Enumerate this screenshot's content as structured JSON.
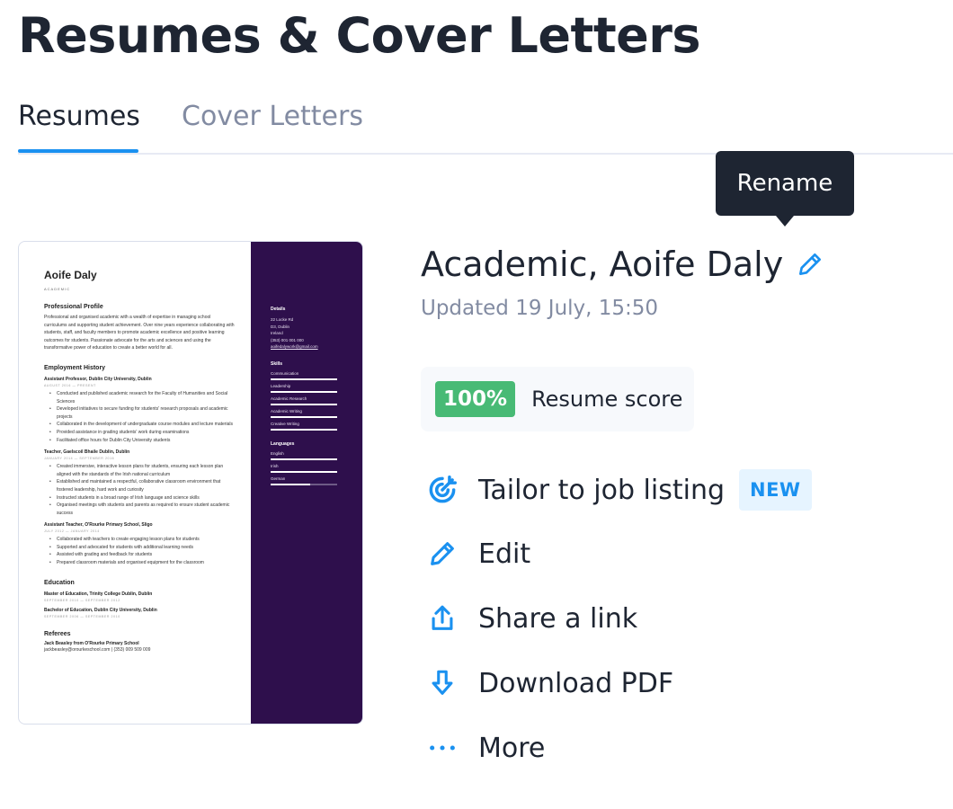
{
  "page": {
    "title": "Resumes & Cover Letters"
  },
  "tabs": [
    {
      "label": "Resumes",
      "active": true
    },
    {
      "label": "Cover Letters",
      "active": false
    }
  ],
  "tooltip": {
    "text": "Rename"
  },
  "document": {
    "title": "Academic, Aoife Daly",
    "updated": "Updated 19 July, 15:50",
    "score": {
      "value": "100%",
      "label": "Resume score"
    }
  },
  "actions": [
    {
      "label": "Tailor to job listing",
      "icon": "target-icon",
      "badge": "NEW"
    },
    {
      "label": "Edit",
      "icon": "pencil-icon"
    },
    {
      "label": "Share a link",
      "icon": "share-icon"
    },
    {
      "label": "Download PDF",
      "icon": "download-icon"
    },
    {
      "label": "More",
      "icon": "more-dots-icon"
    }
  ],
  "colors": {
    "accent": "#1a91f0",
    "text": "#1e2532",
    "muted": "#828ba2",
    "score_green": "#48ba75",
    "resume_sidebar": "#2e0f4c"
  },
  "resume_preview": {
    "name": "Aoife Daly",
    "role": "Academic",
    "profile_heading": "Professional Profile",
    "profile_text": "Professional and organised academic with a wealth of expertise in managing school curriculums and supporting student achievement. Over nine years experience collaborating with students, staff, and faculty members to promote academic excellence and positive learning outcomes for students. Passionate advocate for the arts and sciences and using the transformative power of education to create a better world for all.",
    "employment_heading": "Employment History",
    "jobs": [
      {
        "title": "Assistant Professor, Dublin City University, Dublin",
        "dates": "AUGUST 2016 — PRESENT",
        "bullets": [
          "Conducted and published academic research for the Faculty of Humanities and Social Sciences",
          "Developed initiatives to secure funding for students' research proposals and academic projects",
          "Collaborated in the development of undergraduate course modules and lecture materials",
          "Provided assistance in grading students' work during examinations",
          "Facilitated office hours for Dublin City University students"
        ]
      },
      {
        "title": "Teacher, Gaelscoil Bhaile Dublin, Dublin",
        "dates": "JANUARY 2014 — SEPTEMBER 2016",
        "bullets": [
          "Created immersive, interactive lesson plans for students, ensuring each lesson plan aligned with the standards of the Irish national curriculum",
          "Established and maintained a respectful, collaborative classroom environment that fostered leadership, hard work and curiosity",
          "Instructed students in a broad range of Irish language and science skills",
          "Organised meetings with students and parents as required to ensure student academic success"
        ]
      },
      {
        "title": "Assistant Teacher, O'Rourke Primary School, Sligo",
        "dates": "JULY 2012 — JANUARY 2014",
        "bullets": [
          "Collaborated with teachers to create engaging lesson plans for students",
          "Supported and advocated for students with additional learning needs",
          "Assisted with grading and feedback for students",
          "Prepared classroom materials and organised equipment for the classroom"
        ]
      }
    ],
    "education_heading": "Education",
    "education": [
      {
        "title": "Master of Education, Trinity College Dublin, Dublin",
        "dates": "SEPTEMBER 2010 — SEPTEMBER 2012"
      },
      {
        "title": "Bachelor of Education, Dublin City University, Dublin",
        "dates": "SEPTEMBER 2006 — SEPTEMBER 2010"
      }
    ],
    "referees_heading": "Referees",
    "referee_name": "Jack Beasley from O'Rourke Primary School",
    "referee_contact": "jackbeasley@orourkeschool.com  |  (353) 009 509 009",
    "details_heading": "Details",
    "details": [
      "22 Locke Rd",
      "D3, Dublin",
      "Ireland",
      "(353) 001 001 000"
    ],
    "details_email": "aoifedalywork@gmail.com",
    "skills_heading": "Skills",
    "skills": [
      {
        "name": "Communication",
        "level": 1.0
      },
      {
        "name": "Leadership",
        "level": 1.0
      },
      {
        "name": "Academic Research",
        "level": 1.0
      },
      {
        "name": "Academic Writing",
        "level": 1.0
      },
      {
        "name": "Creative Writing",
        "level": 1.0
      }
    ],
    "languages_heading": "Languages",
    "languages": [
      {
        "name": "English",
        "level": 1.0
      },
      {
        "name": "Irish",
        "level": 1.0
      },
      {
        "name": "German",
        "level": 0.6
      }
    ]
  }
}
